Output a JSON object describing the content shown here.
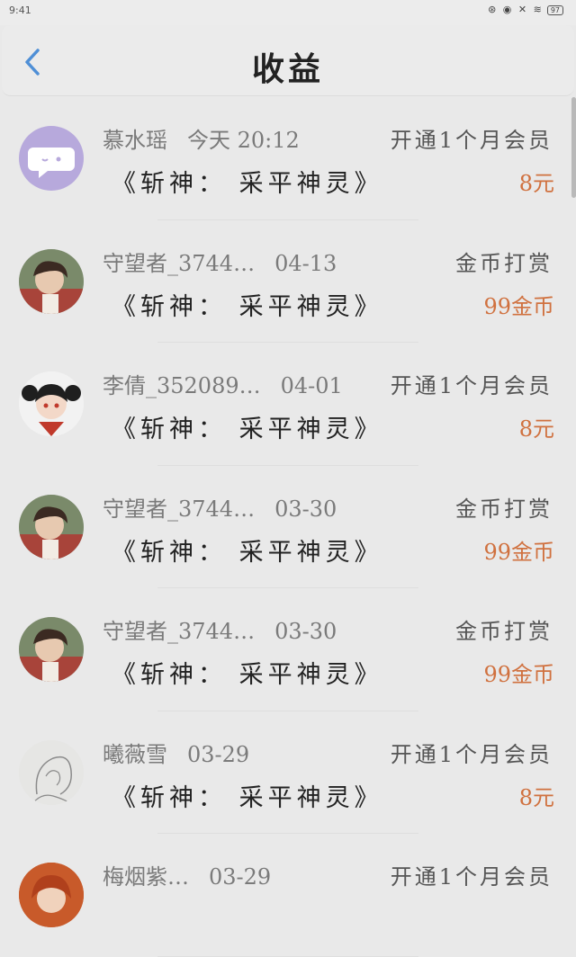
{
  "status_bar": {
    "time": "9:41",
    "icons": "⊛ ◉ ✕ ≋",
    "battery": "97"
  },
  "header": {
    "title": "收益"
  },
  "items": [
    {
      "name": "慕水瑶",
      "date": "今天 20:12",
      "type": "开通1个月会员",
      "book": "《斩神：  采平神灵》",
      "amount": "8元",
      "avatar": "chat-bubble"
    },
    {
      "name": "守望者_3744…",
      "date": "04-13",
      "type": "金币打赏",
      "book": "《斩神：  采平神灵》",
      "amount": "99金币",
      "avatar": "anime-boy"
    },
    {
      "name": "李倩_352089…",
      "date": "04-01",
      "type": "开通1个月会员",
      "book": "《斩神：  采平神灵》",
      "amount": "8元",
      "avatar": "anime-girl"
    },
    {
      "name": "守望者_3744…",
      "date": "03-30",
      "type": "金币打赏",
      "book": "《斩神：  采平神灵》",
      "amount": "99金币",
      "avatar": "anime-boy"
    },
    {
      "name": "守望者_3744…",
      "date": "03-30",
      "type": "金币打赏",
      "book": "《斩神：  采平神灵》",
      "amount": "99金币",
      "avatar": "anime-boy"
    },
    {
      "name": "曦薇雪",
      "date": "03-29",
      "type": "开通1个月会员",
      "book": "《斩神：  采平神灵》",
      "amount": "8元",
      "avatar": "sketch"
    },
    {
      "name": "梅烟紫…",
      "date": "03-29",
      "type": "开通1个月会员",
      "book": "",
      "amount": "",
      "avatar": "anime-redhead"
    }
  ]
}
